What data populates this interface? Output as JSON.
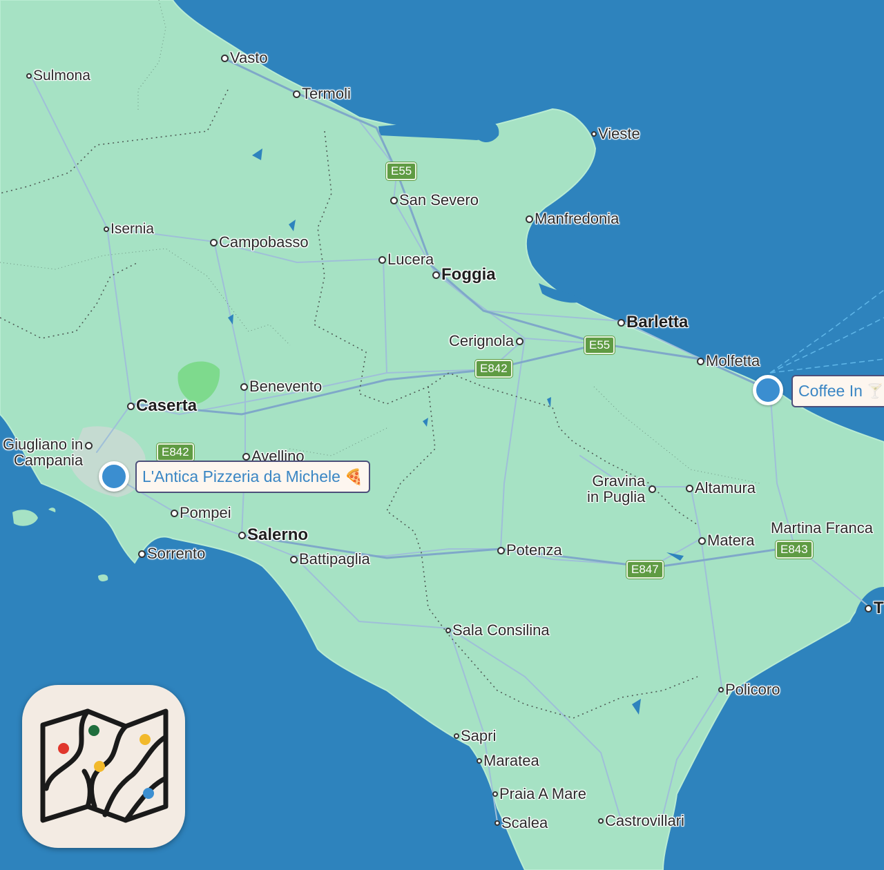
{
  "map": {
    "colors": {
      "sea": "#2e83bd",
      "land": "#a6e2c4",
      "roads": "#9fbfd8",
      "borders": "#5b6b64",
      "pin": "#3b8ed0"
    },
    "cities": {
      "vasto": "Vasto",
      "sulmona": "Sulmona",
      "termoli": "Termoli",
      "vieste": "Vieste",
      "san_severo": "San Severo",
      "manfredonia": "Manfredonia",
      "isernia": "Isernia",
      "campobasso": "Campobasso",
      "lucera": "Lucera",
      "foggia": "Foggia",
      "barletta": "Barletta",
      "cerignola": "Cerignola",
      "molfetta": "Molfetta",
      "benevento": "Benevento",
      "caserta": "Caserta",
      "giugliano_line1": "Giugliano in",
      "giugliano_line2": "Campania",
      "avellino": "Avellino",
      "pompei": "Pompei",
      "salerno": "Salerno",
      "sorrento": "Sorrento",
      "battipaglia": "Battipaglia",
      "potenza": "Potenza",
      "gravina_line1": "Gravina",
      "gravina_line2": "in Puglia",
      "altamura": "Altamura",
      "matera": "Matera",
      "martina_franca": "Martina Franca",
      "taranto_partial": "T",
      "sala_consilina": "Sala Consilina",
      "policoro": "Policoro",
      "sapri": "Sapri",
      "maratea": "Maratea",
      "praia_a_mare": "Praia A Mare",
      "scalea": "Scalea",
      "castrovillari": "Castrovillari"
    },
    "road_shields": {
      "e55_north": "E55",
      "e55_east": "E55",
      "e842_east": "E842",
      "e842_west": "E842",
      "e843": "E843",
      "e847": "E847"
    },
    "places": [
      {
        "name": "L'Antica Pizzeria da Michele",
        "icon": "pizza-icon",
        "glyph": "🍕"
      },
      {
        "name": "Coffee In",
        "icon": "cocktail-glass-icon",
        "glyph": "🍸"
      }
    ]
  },
  "app": {
    "icon": "folded-map-app-icon"
  }
}
